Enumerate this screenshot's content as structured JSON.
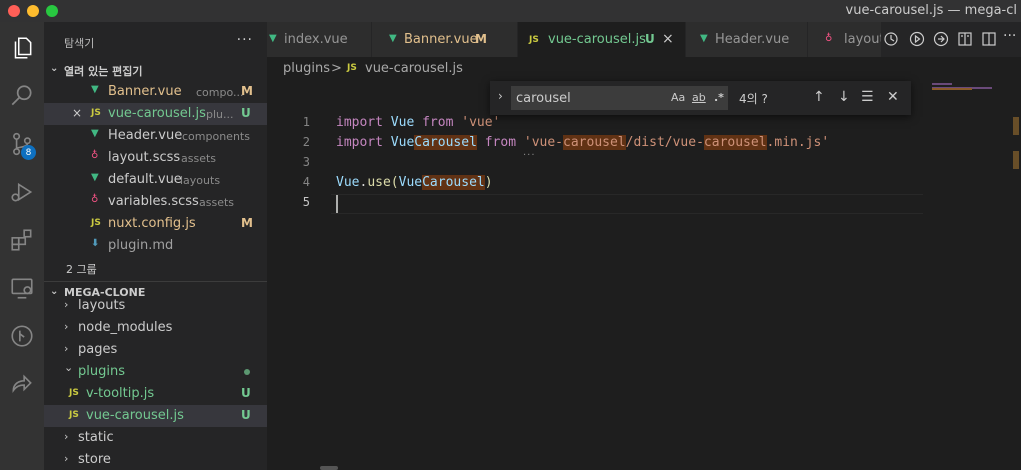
{
  "window": {
    "title": "vue-carousel.js — mega-cl"
  },
  "activity": {
    "scm_badge": "8"
  },
  "sidebar": {
    "title": "탐색기",
    "more": "···",
    "open_editors": {
      "label": "열려 있는 편집기",
      "items": [
        {
          "name": "Banner.vue",
          "desc": "compo...",
          "status": "M",
          "icon": "▼"
        },
        {
          "name": "vue-carousel.js",
          "desc": "plu...",
          "status": "U",
          "icon": "JS",
          "close": "×"
        },
        {
          "name": "Header.vue",
          "desc": "components",
          "status": "",
          "icon": "▼"
        },
        {
          "name": "layout.scss",
          "desc": "assets",
          "status": "",
          "icon": "♁"
        },
        {
          "name": "default.vue",
          "desc": "layouts",
          "status": "",
          "icon": "▼"
        },
        {
          "name": "variables.scss",
          "desc": "assets",
          "status": "",
          "icon": "♁"
        },
        {
          "name": "nuxt.config.js",
          "desc": "",
          "status": "M",
          "icon": "JS"
        },
        {
          "name": "plugin.md",
          "desc": "",
          "status": "",
          "icon": "⬇"
        }
      ],
      "group": "2 그룹"
    },
    "project": {
      "label": "MEGA-CLONE",
      "items": [
        {
          "name": "layouts",
          "chev": "›"
        },
        {
          "name": "node_modules",
          "chev": "›"
        },
        {
          "name": "pages",
          "chev": "›"
        },
        {
          "name": "plugins",
          "chev": "⌄"
        },
        {
          "name": "v-tooltip.js",
          "status": "U",
          "icon": "JS"
        },
        {
          "name": "vue-carousel.js",
          "status": "U",
          "icon": "JS"
        },
        {
          "name": "static",
          "chev": "›"
        },
        {
          "name": "store",
          "chev": "›"
        }
      ]
    }
  },
  "tabs": [
    {
      "label": "index.vue",
      "icon": "▼",
      "status": ""
    },
    {
      "label": "Banner.vue",
      "icon": "▼",
      "status": "M"
    },
    {
      "label": "vue-carousel.js",
      "icon": "JS",
      "status": "U",
      "close": "×"
    },
    {
      "label": "Header.vue",
      "icon": "▼",
      "status": ""
    },
    {
      "label": "layout",
      "icon": "♁",
      "status": ""
    }
  ],
  "breadcrumb": {
    "folder": "plugins",
    "sep": ">",
    "icon": "JS",
    "file": "vue-carousel.js"
  },
  "find": {
    "value": "carousel",
    "match_case": "Aa",
    "whole_word": "ab",
    "regex": ".*",
    "count": "4의 ?",
    "prev": "↑",
    "next": "↓",
    "in_selection": "☰",
    "close": "✕",
    "toggle": "›"
  },
  "editor": {
    "line_numbers": [
      "1",
      "2",
      "3",
      "4",
      "5"
    ],
    "line1": {
      "kw1": "import",
      "v": "Vue",
      "kw2": "from",
      "s": "'vue'"
    },
    "line2": {
      "kw1": "import",
      "v1": "Vue",
      "v2": "Carousel",
      "kw2": "from",
      "s1": "'vue-",
      "s2": "carousel",
      "s3": "/dist/vue-",
      "s4": "carousel",
      "s5": ".min.js'"
    },
    "line4": {
      "a": "Vue",
      "b": ".",
      "c": "use",
      "d": "(",
      "e": "Vue",
      "f": "Carousel",
      "g": ")"
    },
    "squiggle": "···"
  }
}
